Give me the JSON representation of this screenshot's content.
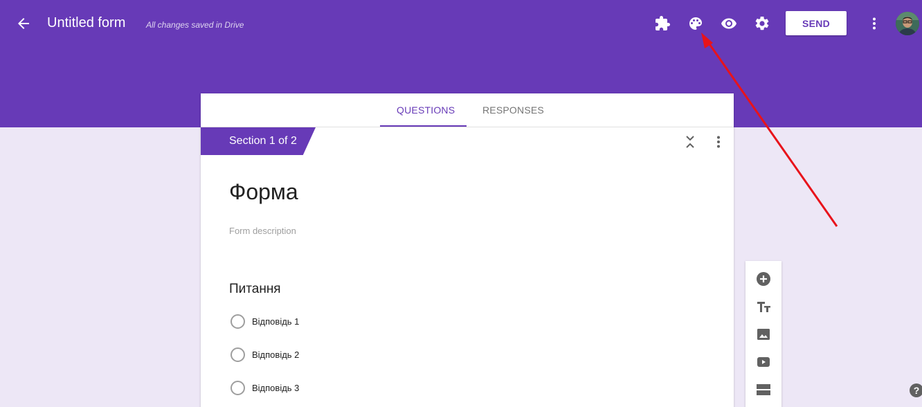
{
  "header": {
    "title": "Untitled form",
    "save_status": "All changes saved in Drive",
    "send_label": "SEND",
    "icons": [
      "back-arrow-icon",
      "addons-icon",
      "palette-icon",
      "preview-eye-icon",
      "settings-gear-icon",
      "more-vert-icon",
      "avatar"
    ],
    "accent_color": "#673ab7"
  },
  "tabs": [
    {
      "label": "QUESTIONS",
      "active": true
    },
    {
      "label": "RESPONSES",
      "active": false
    }
  ],
  "section": {
    "label": "Section 1 of 2"
  },
  "form": {
    "title": "Форма",
    "description_placeholder": "Form description"
  },
  "question": {
    "title": "Питання",
    "options": [
      "Відповідь 1",
      "Відповідь 2",
      "Відповідь 3"
    ]
  },
  "sidebar_tools": [
    "add-question-icon",
    "add-title-icon",
    "add-image-icon",
    "add-video-icon",
    "add-section-icon"
  ],
  "annotation": {
    "color": "#e8131b",
    "points_to": "palette-icon"
  }
}
